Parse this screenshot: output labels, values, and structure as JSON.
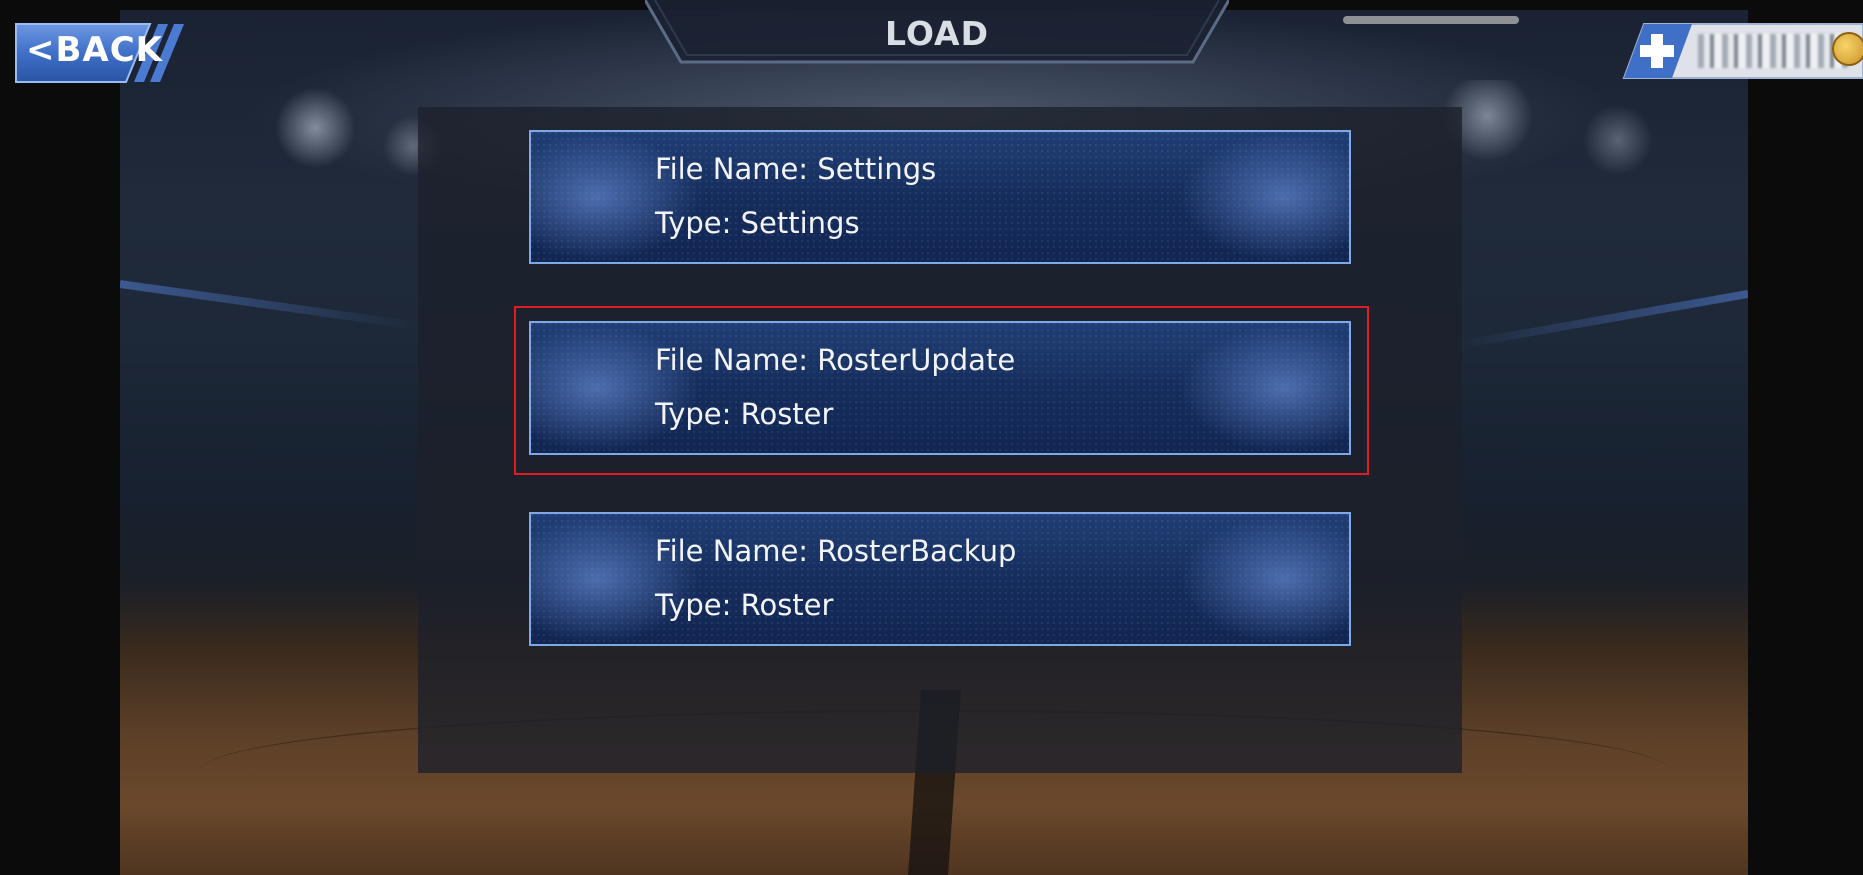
{
  "header": {
    "title": "LOAD",
    "back_label": "<BACK"
  },
  "currency": {
    "add_icon": "plus-icon",
    "coin_icon": "coin-icon"
  },
  "files": [
    {
      "name_label": "File Name:",
      "name": "Settings",
      "type_label": "Type:",
      "type": "Settings",
      "highlighted": false
    },
    {
      "name_label": "File Name:",
      "name": "RosterUpdate",
      "type_label": "Type:",
      "type": "Roster",
      "highlighted": true
    },
    {
      "name_label": "File Name:",
      "name": "RosterBackup",
      "type_label": "Type:",
      "type": "Roster",
      "highlighted": false
    }
  ],
  "colors": {
    "card_border": "#7fa8e6",
    "card_fill": "#152d5c",
    "highlight": "#e01b24",
    "back_button": "#3f6fc7"
  }
}
